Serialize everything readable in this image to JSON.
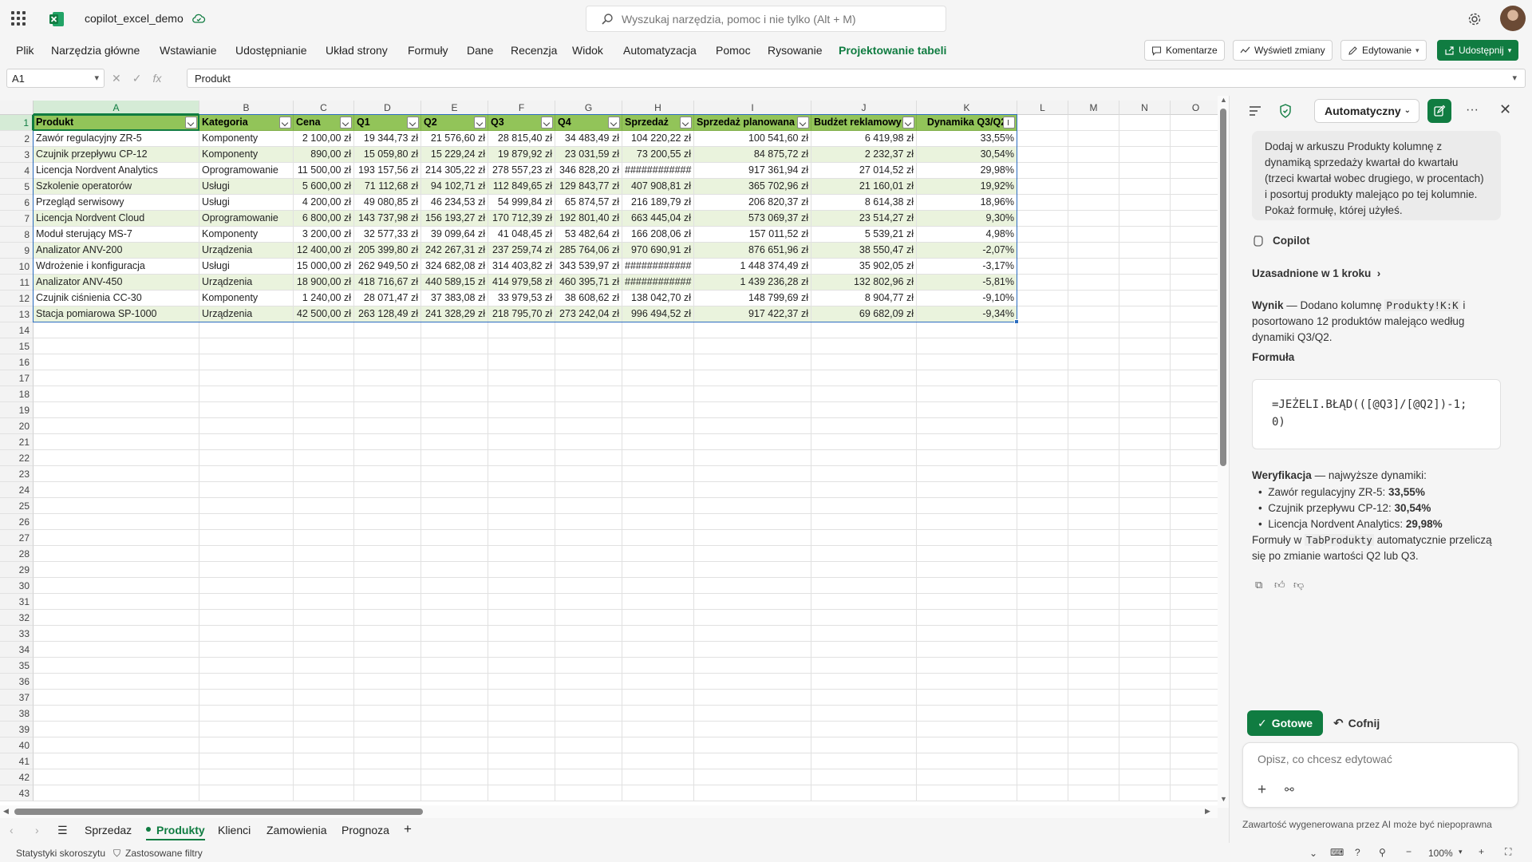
{
  "app": {
    "doc_title": "copilot_excel_demo"
  },
  "search": {
    "placeholder": "Wyszukaj narzędzia, pomoc i nie tylko (Alt + M)"
  },
  "menu": {
    "items": [
      "Plik",
      "Narzędzia główne",
      "Wstawianie",
      "Udostępnianie",
      "Układ strony",
      "Formuły",
      "Dane",
      "Recenzja",
      "Widok",
      "Automatyzacja",
      "Pomoc",
      "Rysowanie",
      "Projektowanie tabeli"
    ],
    "buttons": {
      "comments": "Komentarze",
      "show_changes": "Wyświetl zmiany",
      "editing": "Edytowanie",
      "share": "Udostępnij"
    }
  },
  "formula_bar": {
    "name_box": "A1",
    "fx": "fx",
    "content": "Produkt"
  },
  "grid": {
    "columns": [
      "A",
      "B",
      "C",
      "D",
      "E",
      "F",
      "G",
      "H",
      "I",
      "J",
      "K",
      "L",
      "M",
      "N",
      "O"
    ],
    "row_numbers": [
      "1",
      "2",
      "3",
      "4",
      "5",
      "6",
      "7",
      "8",
      "9",
      "10",
      "11",
      "12",
      "13",
      "14",
      "15",
      "16",
      "17",
      "18",
      "19",
      "20",
      "21",
      "22",
      "23",
      "24",
      "25",
      "26",
      "27",
      "28",
      "29",
      "30",
      "31",
      "32",
      "33",
      "34",
      "35",
      "36",
      "37",
      "38",
      "39",
      "40",
      "41",
      "42",
      "43"
    ],
    "headers": [
      "Produkt",
      "Kategoria",
      "Cena",
      "Q1",
      "Q2",
      "Q3",
      "Q4",
      "Sprzedaż",
      "Sprzedaż planowana",
      "Budżet reklamowy",
      "Dynamika Q3/Q2"
    ],
    "rows": [
      [
        "Zawór regulacyjny ZR-5",
        "Komponenty",
        "2 100,00 zł",
        "19 344,73 zł",
        "21 576,60 zł",
        "28 815,40 zł",
        "34 483,49 zł",
        "104 220,22 zł",
        "100 541,60 zł",
        "6 419,98 zł",
        "33,55%"
      ],
      [
        "Czujnik przepływu CP-12",
        "Komponenty",
        "890,00 zł",
        "15 059,80 zł",
        "15 229,24 zł",
        "19 879,92 zł",
        "23 031,59 zł",
        "73 200,55 zł",
        "84 875,72 zł",
        "2 232,37 zł",
        "30,54%"
      ],
      [
        "Licencja Nordvent Analytics",
        "Oprogramowanie",
        "11 500,00 zł",
        "193 157,56 zł",
        "214 305,22 zł",
        "278 557,23 zł",
        "346 828,20 zł",
        "############",
        "917 361,94 zł",
        "27 014,52 zł",
        "29,98%"
      ],
      [
        "Szkolenie operatorów",
        "Usługi",
        "5 600,00 zł",
        "71 112,68 zł",
        "94 102,71 zł",
        "112 849,65 zł",
        "129 843,77 zł",
        "407 908,81 zł",
        "365 702,96 zł",
        "21 160,01 zł",
        "19,92%"
      ],
      [
        "Przegląd serwisowy",
        "Usługi",
        "4 200,00 zł",
        "49 080,85 zł",
        "46 234,53 zł",
        "54 999,84 zł",
        "65 874,57 zł",
        "216 189,79 zł",
        "206 820,37 zł",
        "8 614,38 zł",
        "18,96%"
      ],
      [
        "Licencja Nordvent Cloud",
        "Oprogramowanie",
        "6 800,00 zł",
        "143 737,98 zł",
        "156 193,27 zł",
        "170 712,39 zł",
        "192 801,40 zł",
        "663 445,04 zł",
        "573 069,37 zł",
        "23 514,27 zł",
        "9,30%"
      ],
      [
        "Moduł sterujący MS-7",
        "Komponenty",
        "3 200,00 zł",
        "32 577,33 zł",
        "39 099,64 zł",
        "41 048,45 zł",
        "53 482,64 zł",
        "166 208,06 zł",
        "157 011,52 zł",
        "5 539,21 zł",
        "4,98%"
      ],
      [
        "Analizator ANV-200",
        "Urządzenia",
        "12 400,00 zł",
        "205 399,80 zł",
        "242 267,31 zł",
        "237 259,74 zł",
        "285 764,06 zł",
        "970 690,91 zł",
        "876 651,96 zł",
        "38 550,47 zł",
        "-2,07%"
      ],
      [
        "Wdrożenie i konfiguracja",
        "Usługi",
        "15 000,00 zł",
        "262 949,50 zł",
        "324 682,08 zł",
        "314 403,82 zł",
        "343 539,97 zł",
        "############",
        "1 448 374,49 zł",
        "35 902,05 zł",
        "-3,17%"
      ],
      [
        "Analizator ANV-450",
        "Urządzenia",
        "18 900,00 zł",
        "418 716,67 zł",
        "440 589,15 zł",
        "414 979,58 zł",
        "460 395,71 zł",
        "############",
        "1 439 236,28 zł",
        "132 802,96 zł",
        "-5,81%"
      ],
      [
        "Czujnik ciśnienia CC-30",
        "Komponenty",
        "1 240,00 zł",
        "28 071,47 zł",
        "37 383,08 zł",
        "33 979,53 zł",
        "38 608,62 zł",
        "138 042,70 zł",
        "148 799,69 zł",
        "8 904,77 zł",
        "-9,10%"
      ],
      [
        "Stacja pomiarowa SP-1000",
        "Urządzenia",
        "42 500,00 zł",
        "263 128,49 zł",
        "241 328,29 zł",
        "218 795,70 zł",
        "273 242,04 zł",
        "996 494,52 zł",
        "917 422,37 zł",
        "69 682,09 zł",
        "-9,34%"
      ]
    ]
  },
  "sheets": {
    "tabs": [
      "Sprzedaz",
      "Produkty",
      "Klienci",
      "Zamowienia",
      "Prognoza"
    ],
    "active": "Produkty"
  },
  "status": {
    "left1": "Statystyki skoroszytu",
    "left2": "Zastosowane filtry",
    "zoom": "100%"
  },
  "copilot": {
    "mode": "Automatyczny",
    "user_message": "Dodaj w arkuszu Produkty kolumnę z dynamiką sprzedaży kwartał do kwartału (trzeci kwartał wobec drugiego, w procentach) i posortuj produkty malejąco po tej kolumnie. Pokaż formułę, której użyłeś.",
    "sender": "Copilot",
    "steps": "Uzasadnione w 1 kroku",
    "result_label": "Wynik",
    "result_pre": " — Dodano kolumnę ",
    "result_code": "Produkty!K:K",
    "result_post": " i posortowano 12 produktów malejąco według dynamiki Q3/Q2.",
    "formula_label": "Formuła",
    "formula": "=JEŻELI.BŁĄD(([@Q3]/[@Q2])-1;\n0)",
    "verification_label": "Weryfikacja",
    "verification_text": " — najwyższe dynamiki:",
    "top": [
      {
        "name": "Zawór regulacyjny ZR-5: ",
        "value": "33,55%"
      },
      {
        "name": "Czujnik przepływu CP-12: ",
        "value": "30,54%"
      },
      {
        "name": "Licencja Nordvent Analytics: ",
        "value": "29,98%"
      }
    ],
    "note_pre": "Formuły w ",
    "note_code": "TabProdukty",
    "note_post": " automatycznie przeliczą się po zmianie wartości Q2 lub Q3.",
    "done": "Gotowe",
    "undo": "Cofnij",
    "prompt_placeholder": "Opisz, co chcesz edytować",
    "disclaimer": "Zawartość wygenerowana przez AI może być niepoprawna"
  },
  "colors": {
    "accent": "#107c41",
    "table_header": "#92c459",
    "band": "#eaf3dd"
  }
}
